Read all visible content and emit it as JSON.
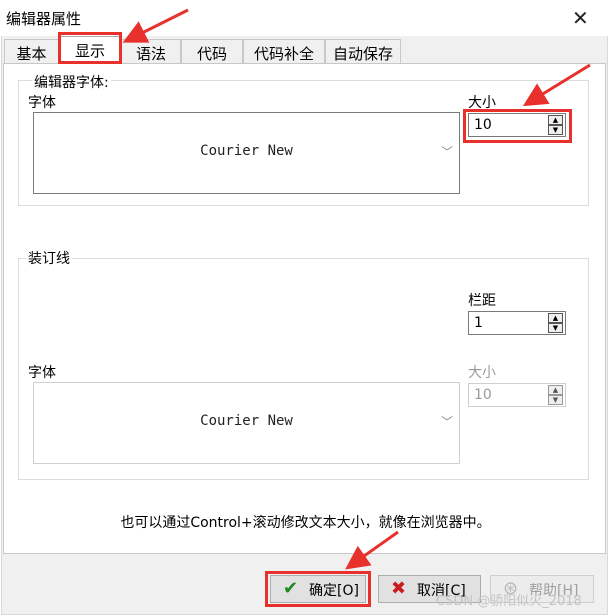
{
  "window": {
    "title": "编辑器属性",
    "close_glyph": "✕"
  },
  "tabs": [
    {
      "label": "基本"
    },
    {
      "label": "显示"
    },
    {
      "label": "语法"
    },
    {
      "label": "代码"
    },
    {
      "label": "代码补全"
    },
    {
      "label": "自动保存"
    }
  ],
  "editor_font_group": {
    "title": "编辑器字体:",
    "font_label": "字体",
    "font_value": "Courier New",
    "size_label": "大小",
    "size_value": "10"
  },
  "gutter_group": {
    "title": "装订线",
    "margin_label": "栏距",
    "margin_value": "1",
    "font_label": "字体",
    "font_value": "Courier New",
    "size_label": "大小",
    "size_value": "10"
  },
  "note": "也可以通过Control+滚动修改文本大小，就像在浏览器中。",
  "buttons": {
    "ok": "确定[O]",
    "cancel": "取消[C]",
    "help": "帮助[H]"
  },
  "watermark": "CSDN @骄阳似火_2018",
  "colors": {
    "highlight": "#e8312d",
    "ok_check": "#1e8a1e",
    "cancel_x": "#c81e1e"
  }
}
